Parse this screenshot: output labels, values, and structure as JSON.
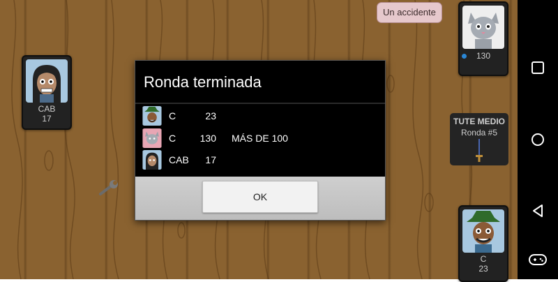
{
  "players": {
    "left": {
      "name": "CAB",
      "score": "17",
      "avatar": "girl-avatar-icon"
    },
    "top_right": {
      "name": "",
      "score": "130",
      "avatar": "cat-avatar-icon",
      "status_dot_color": "#2a87d6"
    },
    "bottom_right": {
      "name": "C",
      "score": "23",
      "avatar": "hat-man-avatar-icon"
    }
  },
  "speech_bubble": {
    "text": "Un accidente"
  },
  "round_panel": {
    "title": "TUTE MEDIO",
    "round": "Ronda #5",
    "icon": "sword-icon"
  },
  "dialog": {
    "title": "Ronda terminada",
    "rows": [
      {
        "name": "C",
        "score": "23",
        "note": "",
        "avatar": "hat-man-avatar-icon"
      },
      {
        "name": "C",
        "score": "130",
        "note": "MÁS DE 100",
        "avatar": "cat-avatar-icon"
      },
      {
        "name": "CAB",
        "score": "17",
        "note": "",
        "avatar": "girl-avatar-icon"
      }
    ],
    "ok_label": "OK"
  },
  "nav": {
    "buttons": [
      "recent-apps-icon",
      "home-icon",
      "back-icon",
      "gamepad-icon"
    ],
    "color": "#000000"
  },
  "colors": {
    "table_wood": "#8a6230",
    "dialog_bg": "#000000",
    "speech_bg": "#e6c8cc"
  }
}
